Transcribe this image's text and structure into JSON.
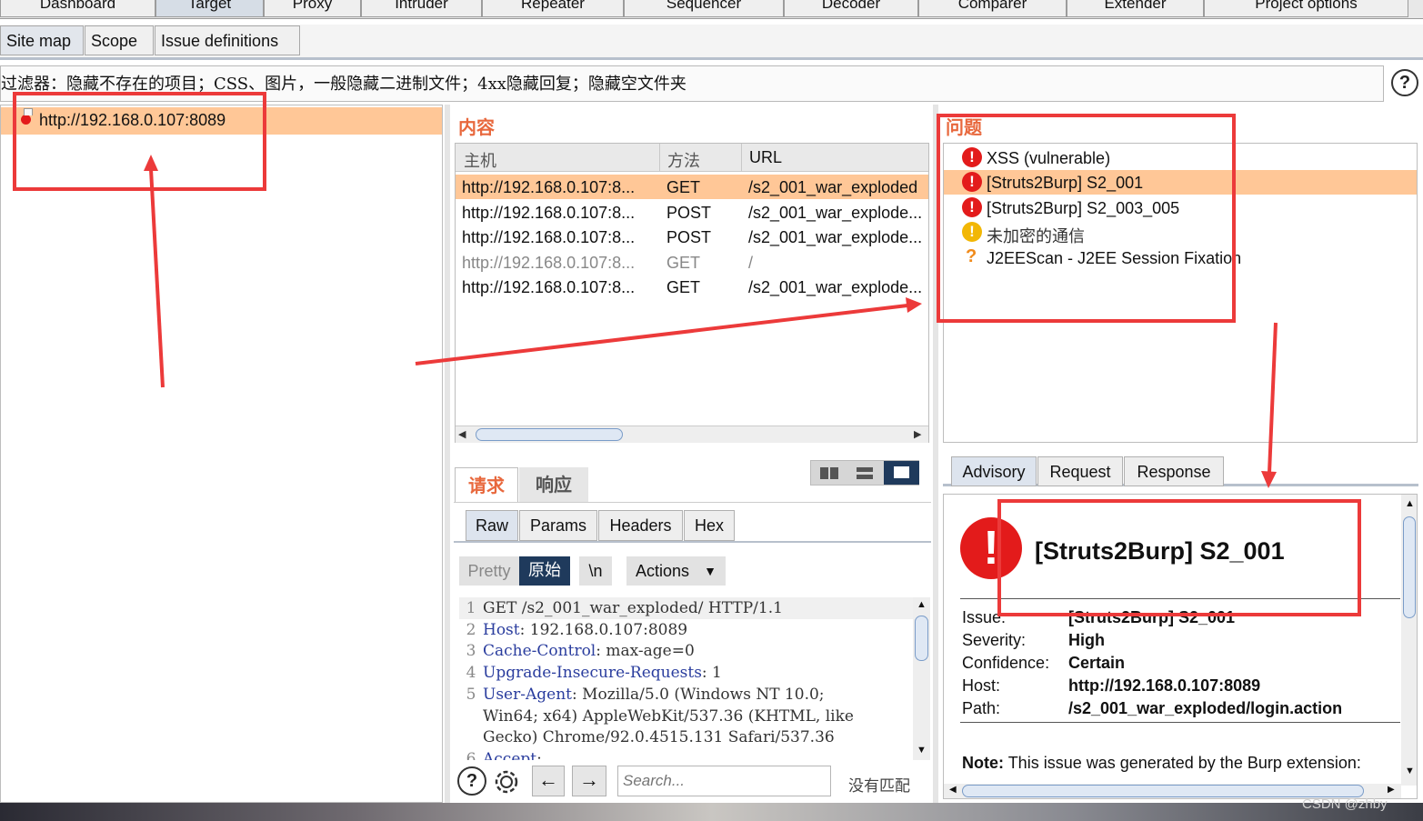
{
  "top_tabs": [
    "Dashboard",
    "Target",
    "Proxy",
    "Intruder",
    "Repeater",
    "Sequencer",
    "Decoder",
    "Comparer",
    "Extender",
    "Project options"
  ],
  "sub_tabs": [
    "Site map",
    "Scope",
    "Issue definitions"
  ],
  "filter_text": "过滤器：隐藏不存在的项目；CSS、图片，一般隐藏二进制文件；4xx隐藏回复；隐藏空文件夹",
  "help_glyph": "?",
  "site_tree": {
    "host": "http://192.168.0.107:8089"
  },
  "content": {
    "title": "内容",
    "columns": [
      "主机",
      "方法",
      "URL"
    ],
    "rows": [
      {
        "host": "http://192.168.0.107:8...",
        "method": "GET",
        "url": "/s2_001_war_exploded"
      },
      {
        "host": "http://192.168.0.107:8...",
        "method": "POST",
        "url": "/s2_001_war_explode..."
      },
      {
        "host": "http://192.168.0.107:8...",
        "method": "POST",
        "url": "/s2_001_war_explode..."
      },
      {
        "host": "http://192.168.0.107:8...",
        "method": "GET",
        "url": "/"
      },
      {
        "host": "http://192.168.0.107:8...",
        "method": "GET",
        "url": "/s2_001_war_explode..."
      }
    ]
  },
  "issues": {
    "title": "问题",
    "items": [
      {
        "label": "XSS (vulnerable)",
        "severity": "high"
      },
      {
        "label": "[Struts2Burp] S2_001",
        "severity": "high"
      },
      {
        "label": "[Struts2Burp] S2_003_005",
        "severity": "high"
      },
      {
        "label": "未加密的通信",
        "severity": "info"
      },
      {
        "label": "J2EEScan - J2EE Session Fixation",
        "severity": "tentative"
      }
    ]
  },
  "req_resp_tabs": [
    "请求",
    "响应"
  ],
  "view_tabs": [
    "Raw",
    "Params",
    "Headers",
    "Hex"
  ],
  "editor_buttons": {
    "pretty": "Pretty",
    "raw": "原始",
    "newline": "\\n",
    "actions": "Actions"
  },
  "request_lines": [
    {
      "n": "1",
      "key": "",
      "val": "GET /s2_001_war_exploded/ HTTP/1.1"
    },
    {
      "n": "2",
      "key": "Host",
      "val": ": 192.168.0.107:8089"
    },
    {
      "n": "3",
      "key": "Cache-Control",
      "val": ": max-age=0"
    },
    {
      "n": "4",
      "key": "Upgrade-Insecure-Requests",
      "val": ": 1"
    },
    {
      "n": "5",
      "key": "User-Agent",
      "val": ": Mozilla/5.0 (Windows NT 10.0;"
    },
    {
      "n": "",
      "key": "",
      "val": "Win64; x64) AppleWebKit/537.36 (KHTML, like"
    },
    {
      "n": "",
      "key": "",
      "val": "Gecko) Chrome/92.0.4515.131 Safari/537.36"
    },
    {
      "n": "6",
      "key": "Accept",
      "val": ":"
    }
  ],
  "search": {
    "placeholder": "Search...",
    "no_match": "没有匹配"
  },
  "advisory_tabs": [
    "Advisory",
    "Request",
    "Response"
  ],
  "advisory": {
    "title": "[Struts2Burp] S2_001",
    "fields": [
      {
        "label": "Issue:",
        "value": "[Struts2Burp] S2_001"
      },
      {
        "label": "Severity:",
        "value": "High"
      },
      {
        "label": "Confidence:",
        "value": "Certain"
      },
      {
        "label": "Host:",
        "value": "http://192.168.0.107:8089"
      },
      {
        "label": "Path:",
        "value": "/s2_001_war_exploded/login.action"
      }
    ],
    "note_label": "Note:",
    "note_text": "This issue was generated by the Burp extension:"
  },
  "watermark": "CSDN @zhby",
  "colors": {
    "selection": "#ffc797",
    "accent": "#e8683d",
    "annotation": "#ec3a3a",
    "high": "#e31b1b",
    "info": "#f2b705"
  }
}
